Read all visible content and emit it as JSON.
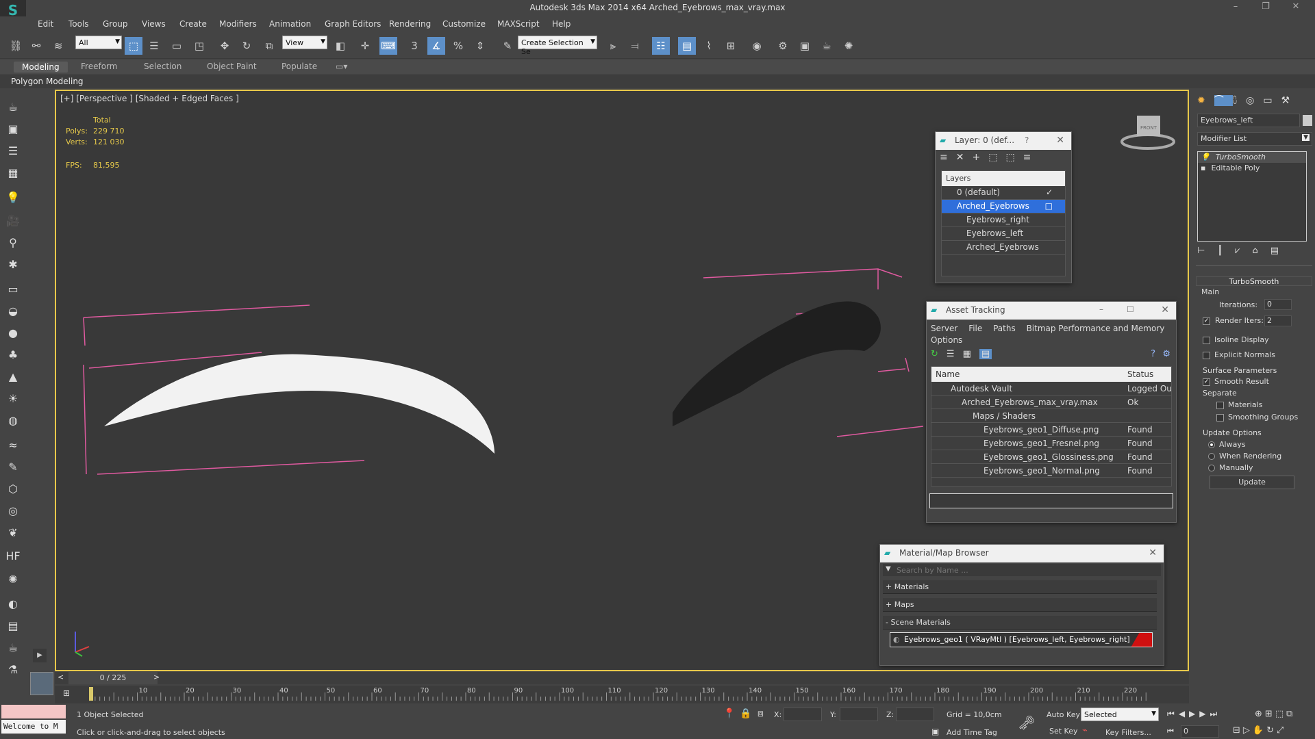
{
  "app": {
    "logo": "S",
    "title": "Autodesk 3ds Max  2014 x64     Arched_Eyebrows_max_vray.max"
  },
  "window_controls": {
    "minimize": "–",
    "restore": "❐",
    "close": "✕"
  },
  "menu": [
    "Edit",
    "Tools",
    "Group",
    "Views",
    "Create",
    "Modifiers",
    "Animation",
    "Graph Editors",
    "Rendering",
    "Customize",
    "MAXScript",
    "Help"
  ],
  "toolbar": {
    "filter": "All",
    "ref_coord": "View",
    "selection_set": "Create Selection Se"
  },
  "ribbon": {
    "tabs": [
      "Modeling",
      "Freeform",
      "Selection",
      "Object Paint",
      "Populate"
    ],
    "sub": "Polygon Modeling"
  },
  "viewport": {
    "label": "[+] [Perspective ] [Shaded + Edged Faces ]",
    "stats": {
      "total_label": "Total",
      "polys_label": "Polys:",
      "polys": "229 710",
      "verts_label": "Verts:",
      "verts": "121 030",
      "fps_label": "FPS:",
      "fps": "81,595"
    },
    "viewcube": "FRONT"
  },
  "layer_dialog": {
    "title": "Layer: 0 (def...",
    "help": "?",
    "header": "Layers",
    "items": [
      {
        "name": "0 (default)",
        "mark": "✓"
      },
      {
        "name": "Arched_Eyebrows",
        "mark": "□"
      },
      {
        "name": "Eyebrows_right",
        "mark": ""
      },
      {
        "name": "Eyebrows_left",
        "mark": ""
      },
      {
        "name": "Arched_Eyebrows",
        "mark": ""
      }
    ]
  },
  "asset_tracking": {
    "title": "Asset Tracking",
    "menu": [
      "Server",
      "File",
      "Paths",
      "Bitmap Performance and Memory"
    ],
    "menu2": "Options",
    "columns": [
      "Name",
      "Status"
    ],
    "rows": [
      {
        "name": "Autodesk Vault",
        "status": "Logged Ou"
      },
      {
        "name": "Arched_Eyebrows_max_vray.max",
        "status": "Ok"
      },
      {
        "name": "Maps / Shaders",
        "status": ""
      },
      {
        "name": "Eyebrows_geo1_Diffuse.png",
        "status": "Found"
      },
      {
        "name": "Eyebrows_geo1_Fresnel.png",
        "status": "Found"
      },
      {
        "name": "Eyebrows_geo1_Glossiness.png",
        "status": "Found"
      },
      {
        "name": "Eyebrows_geo1_Normal.png",
        "status": "Found"
      }
    ]
  },
  "material_browser": {
    "title": "Material/Map Browser",
    "search_placeholder": "Search by Name ...",
    "sections": [
      "+ Materials",
      "+ Maps",
      "- Scene Materials"
    ],
    "scene_material": "Eyebrows_geo1 ( VRayMtl ) [Eyebrows_left, Eyebrows_right]"
  },
  "command_panel": {
    "object_name": "Eyebrows_left",
    "modifier_list": "Modifier List",
    "stack": [
      "TurboSmooth",
      "Editable Poly"
    ],
    "rollout": "TurboSmooth",
    "main": "Main",
    "iterations_label": "Iterations:",
    "iterations": "0",
    "render_iters_label": "Render Iters:",
    "render_iters": "2",
    "isoline": "Isoline Display",
    "explicit_normals": "Explicit Normals",
    "surface_params": "Surface Parameters",
    "smooth_result": "Smooth Result",
    "separate": "Separate",
    "materials": "Materials",
    "smoothing_groups": "Smoothing Groups",
    "update_options": "Update Options",
    "always": "Always",
    "when_rendering": "When Rendering",
    "manually": "Manually",
    "update_button": "Update"
  },
  "timeline": {
    "frame": "0 / 225",
    "ticks": [
      "10",
      "20",
      "30",
      "40",
      "50",
      "60",
      "70",
      "80",
      "90",
      "100",
      "110",
      "120",
      "130",
      "140",
      "150",
      "160",
      "170",
      "180",
      "190",
      "200",
      "210",
      "220"
    ]
  },
  "status": {
    "script_listener": "Welcome to M",
    "selected": "1 Object Selected",
    "prompt": "Click or click-and-drag to select objects",
    "x_label": "X:",
    "y_label": "Y:",
    "z_label": "Z:",
    "grid": "Grid = 10,0cm",
    "auto_key": "Auto Key",
    "selected_dd": "Selected",
    "set_key": "Set Key",
    "key_filters": "Key Filters...",
    "add_time_tag": "Add Time Tag",
    "frame_field": "0"
  }
}
